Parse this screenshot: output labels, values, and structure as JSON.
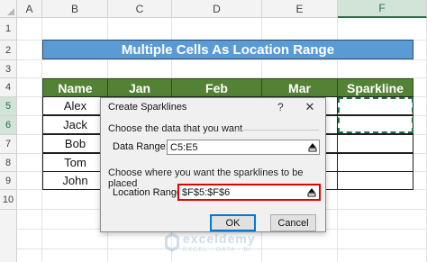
{
  "columns": [
    "A",
    "B",
    "C",
    "D",
    "E",
    "F"
  ],
  "rows": [
    "1",
    "2",
    "3",
    "4",
    "5",
    "6",
    "7",
    "8",
    "9",
    "10"
  ],
  "title": "Multiple Cells As Location Range",
  "table": {
    "headers": [
      "Name",
      "Jan",
      "Feb",
      "Mar",
      "Sparkline"
    ],
    "names": [
      "Alex",
      "Jack",
      "Bob",
      "Tom",
      "John"
    ]
  },
  "dialog": {
    "title": "Create Sparklines",
    "help": "?",
    "close": "✕",
    "section1": "Choose the data that you want",
    "data_range_label": "Data Range:",
    "data_range_value": "C5:E5",
    "section2": "Choose where you want the sparklines to be placed",
    "location_range_label": "Location Range:",
    "location_range_value": "$F$5:$F$6",
    "ok": "OK",
    "cancel": "Cancel"
  },
  "watermark": {
    "name": "exceldemy",
    "tagline": "EXCEL · DATA · BI"
  },
  "colors": {
    "title_bg": "#5b9bd5",
    "header_bg": "#548235",
    "highlight": "#e00000",
    "selection": "#217346"
  }
}
